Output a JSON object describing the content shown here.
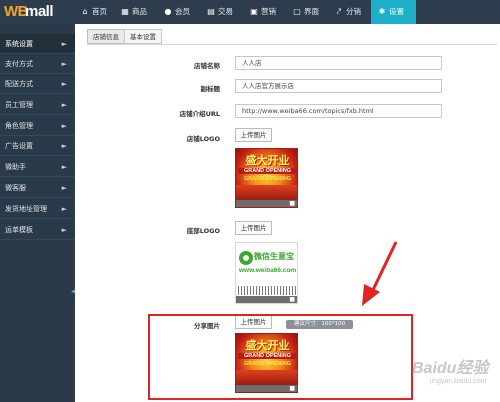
{
  "logo": {
    "part1": "WB",
    "part2": "mall"
  },
  "nav": [
    {
      "label": "首页",
      "icon": "home-icon",
      "glyph": "⌂"
    },
    {
      "label": "商品",
      "icon": "grid-icon",
      "glyph": "▦"
    },
    {
      "label": "会员",
      "icon": "user-icon",
      "glyph": "●"
    },
    {
      "label": "交易",
      "icon": "trade-icon",
      "glyph": "▤"
    },
    {
      "label": "营销",
      "icon": "marketing-icon",
      "glyph": "▣"
    },
    {
      "label": "界面",
      "icon": "interface-icon",
      "glyph": "▢"
    },
    {
      "label": "分销",
      "icon": "share-icon",
      "glyph": "⤤"
    },
    {
      "label": "设置",
      "icon": "gear-icon",
      "glyph": "✱"
    }
  ],
  "sidebar": {
    "items": [
      {
        "label": "系统设置"
      },
      {
        "label": "支付方式"
      },
      {
        "label": "配送方式"
      },
      {
        "label": "员工管理"
      },
      {
        "label": "角色管理"
      },
      {
        "label": "广告设置"
      },
      {
        "label": "微助手"
      },
      {
        "label": "微客服"
      },
      {
        "label": "发货地址管理"
      },
      {
        "label": "运单模板"
      }
    ]
  },
  "tabs": [
    {
      "label": "店铺信息"
    },
    {
      "label": "基本设置"
    }
  ],
  "form": {
    "store_name": {
      "label": "店铺名称",
      "value": "人人店"
    },
    "subtitle": {
      "label": "副标题",
      "value": "人人店官方展示店"
    },
    "intro_url": {
      "label": "店铺介绍URL",
      "value": "http://www.weiba66.com/topics/fxb.html"
    },
    "logo": {
      "label": "店铺LOGO",
      "button": "上传图片"
    },
    "bottom_logo": {
      "label": "底部LOGO",
      "button": "上传图片"
    },
    "share_image": {
      "label": "分享图片",
      "button": "上传图片",
      "hint": "建议尺寸：100*100"
    }
  },
  "images": {
    "grand": {
      "line1": "盛大开业",
      "line2": "GRAND OPENING",
      "line3": "GRAND OPENING"
    },
    "weixin": {
      "line1": "微信生意宝",
      "line2": "www.weiba66.com"
    }
  },
  "watermark": {
    "text": "Baidu经验",
    "sub": "jingyan.baidu.com"
  },
  "colors": {
    "topbar": "#2e3d4d",
    "accent": "#1bb0c7",
    "logo_accent": "#f5a623",
    "highlight": "#e02424"
  }
}
